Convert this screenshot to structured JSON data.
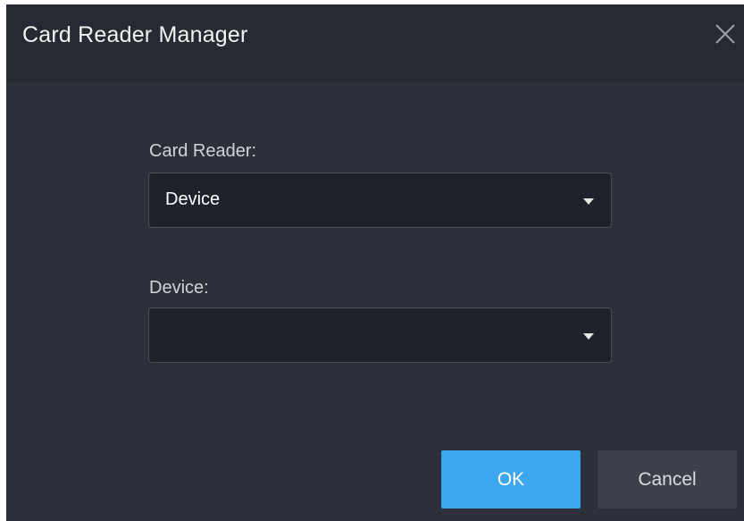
{
  "dialog": {
    "title": "Card Reader Manager",
    "close_icon": "close-icon"
  },
  "form": {
    "card_reader": {
      "label": "Card Reader:",
      "value": "Device",
      "dropdown_icon": "chevron-down-icon"
    },
    "device": {
      "label": "Device:",
      "value": "",
      "dropdown_icon": "chevron-down-icon"
    }
  },
  "buttons": {
    "ok_label": "OK",
    "cancel_label": "Cancel"
  },
  "colors": {
    "dialog_background": "#2b303b",
    "titlebar_background": "#262a33",
    "field_background": "#1f222b",
    "primary_button": "#3ca7ee",
    "secondary_button": "#3b404b"
  }
}
